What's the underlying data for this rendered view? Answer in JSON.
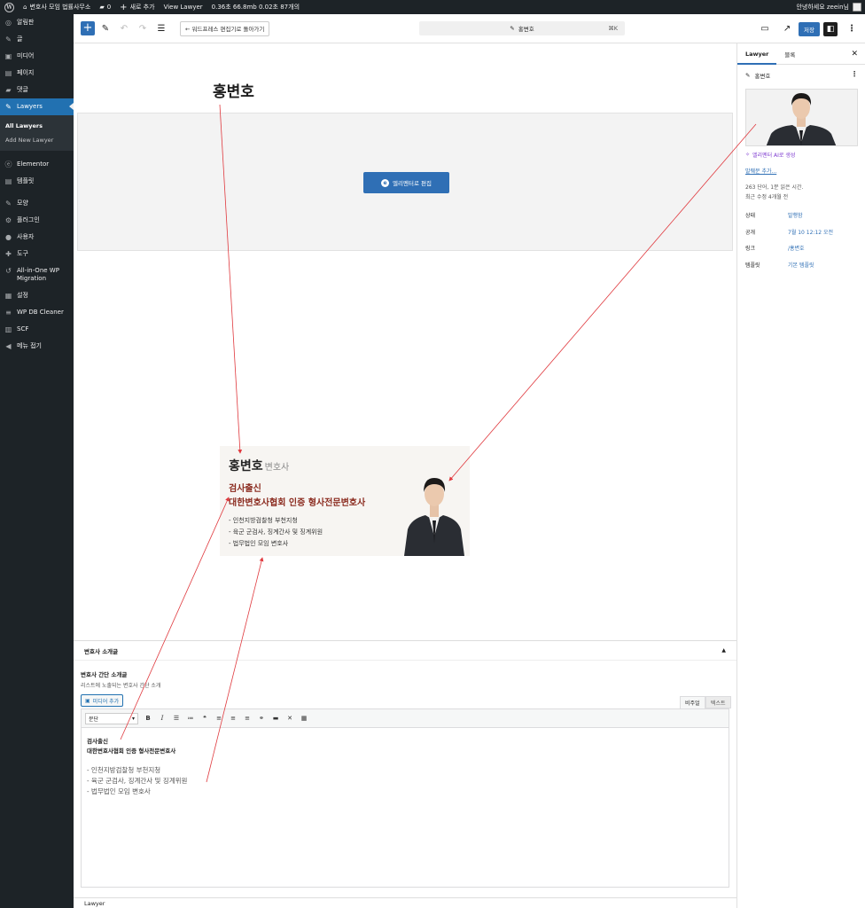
{
  "admin_bar": {
    "site_name": "변호사 모임 법률사무소",
    "comments_count": "0",
    "new_label": "새로 추가",
    "view_label": "View Lawyer",
    "stats": "0.36초  66.8mb  0.02초  87개의",
    "greeting": "안녕하세요 zeein님"
  },
  "sidebar": {
    "items": [
      {
        "icon": "dashboard-icon",
        "glyph": "◎",
        "label": "알림판"
      },
      {
        "icon": "pin-icon",
        "glyph": "✎",
        "label": "글"
      },
      {
        "icon": "media-icon",
        "glyph": "▣",
        "label": "미디어"
      },
      {
        "icon": "page-icon",
        "glyph": "▤",
        "label": "페이지"
      },
      {
        "icon": "comment-icon",
        "glyph": "▰",
        "label": "댓글"
      }
    ],
    "active": {
      "icon": "pin-icon",
      "glyph": "✎",
      "label": "Lawyers"
    },
    "submenu": [
      "All Lawyers",
      "Add New Lawyer"
    ],
    "items2": [
      {
        "icon": "elementor-icon",
        "glyph": "ⓔ",
        "label": "Elementor"
      },
      {
        "icon": "template-icon",
        "glyph": "▤",
        "label": "템플릿"
      }
    ],
    "items3": [
      {
        "icon": "brush-icon",
        "glyph": "✎",
        "label": "모양"
      },
      {
        "icon": "plugin-icon",
        "glyph": "⚙",
        "label": "플러그인"
      },
      {
        "icon": "user-icon",
        "glyph": "●",
        "label": "사용자"
      },
      {
        "icon": "tool-icon",
        "glyph": "✚",
        "label": "도구"
      },
      {
        "icon": "migration-icon",
        "glyph": "↺",
        "label": "All-in-One WP Migration"
      },
      {
        "icon": "settings-icon",
        "glyph": "▦",
        "label": "설정"
      },
      {
        "icon": "database-icon",
        "glyph": "≡",
        "label": "WP DB Cleaner"
      },
      {
        "icon": "scf-icon",
        "glyph": "▥",
        "label": "SCF"
      },
      {
        "icon": "collapse-icon",
        "glyph": "◀",
        "label": "메뉴 접기"
      }
    ]
  },
  "header": {
    "back_label": "← 워드프레스 편집기로 돌아가기",
    "doc_title": "홍변호",
    "shortcut": "⌘K",
    "save_label": "저장"
  },
  "canvas": {
    "title": "홍변호",
    "elementor_button": "엘리멘터로 편집"
  },
  "preview": {
    "name": "홍변호",
    "role": "변호사",
    "line1": "검사출신",
    "line2": "대한변호사협회 인증 형사전문변호사",
    "bullets": [
      "- 인천지방검찰청 부천지청",
      "- 육군 군검사, 징계간사 및 징계위원",
      "- 법무법인 모임 변호사"
    ]
  },
  "metabox": {
    "title": "변호사 소개글",
    "field_label": "변호사 간단 소개글",
    "field_desc": "리스트에 노출되는 변호사 간단 소개",
    "media_button": "미디어 추가",
    "tab_visual": "비주얼",
    "tab_text": "텍스트",
    "format_select": "문단",
    "content_bold": [
      "검사출신",
      "대한변호사협회 인증 형사전문변호사"
    ],
    "content_lines": [
      "- 인천지방검찰청 부천지청",
      "- 육군 군검사, 징계간사 및 징계위원",
      "- 법무법인 모임 변호사"
    ]
  },
  "footer": {
    "breadcrumb": "Lawyer"
  },
  "settings": {
    "tab_post": "Lawyer",
    "tab_block": "블록",
    "post_title": "홍변호",
    "ai_link": "엘리멘터 AI로 생성",
    "excerpt_link": "발췌문 추가...",
    "stats_line1": "263 단어, 1분 읽은 시간.",
    "stats_line2": "최근 수정 4개월 전",
    "rows": [
      {
        "key": "상태",
        "value": "발행함"
      },
      {
        "key": "공개",
        "value": "7월 10 12:12 오전"
      },
      {
        "key": "링크",
        "value": "/홍변호"
      },
      {
        "key": "템플릿",
        "value": "기본 템플릿"
      }
    ]
  },
  "colors": {
    "admin_dark": "#1d2327",
    "accent": "#2f6fb5",
    "preview_heading": "#8b2b1f",
    "annotation_line": "#e0393e"
  }
}
